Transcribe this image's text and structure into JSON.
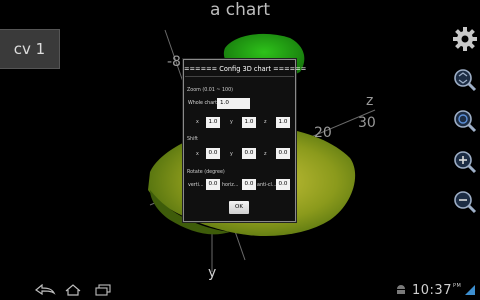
{
  "app": {
    "title": "a chart",
    "tab_label": "cv 1"
  },
  "axes": {
    "x_tick_neg": "-8",
    "z_label": "z",
    "z_tick_30": "30",
    "z_tick_20": "20",
    "y_label": "y"
  },
  "dialog": {
    "title": "====== Config 3D chart ======",
    "zoom_section": "Zoom (0.01 ~ 100)",
    "whole_chart_label": "Whole chart",
    "whole_chart_value": "1.0",
    "zoom_x_label": "x",
    "zoom_x_value": "1.0",
    "zoom_y_label": "y",
    "zoom_y_value": "1.0",
    "zoom_z_label": "z",
    "zoom_z_value": "1.0",
    "shift_section": "Shift",
    "shift_x_label": "x",
    "shift_x_value": "0.0",
    "shift_y_label": "y",
    "shift_y_value": "0.0",
    "shift_z_label": "z",
    "shift_z_value": "0.0",
    "rotate_section": "Rotate (degree)",
    "rot_vert_label": "verti...",
    "rot_vert_value": "0.0",
    "rot_horiz_label": "horiz...",
    "rot_horiz_value": "0.0",
    "rot_anti_label": "anti-cl...",
    "rot_anti_value": "0.0",
    "ok_label": "OK"
  },
  "status_bar": {
    "time": "10:37",
    "am_pm": "PM"
  },
  "colors": {
    "surface_green": "#1f9d12",
    "surface_yellow": "#9aa61a",
    "dialog_bg": "#101010",
    "accent_blue": "#3d6fb8"
  },
  "icons": [
    "gear-icon",
    "zoom-fit-icon",
    "zoom-reset-icon",
    "zoom-in-icon",
    "zoom-out-icon",
    "back-icon",
    "home-icon",
    "recent-apps-icon",
    "android-icon",
    "signal-icon"
  ]
}
